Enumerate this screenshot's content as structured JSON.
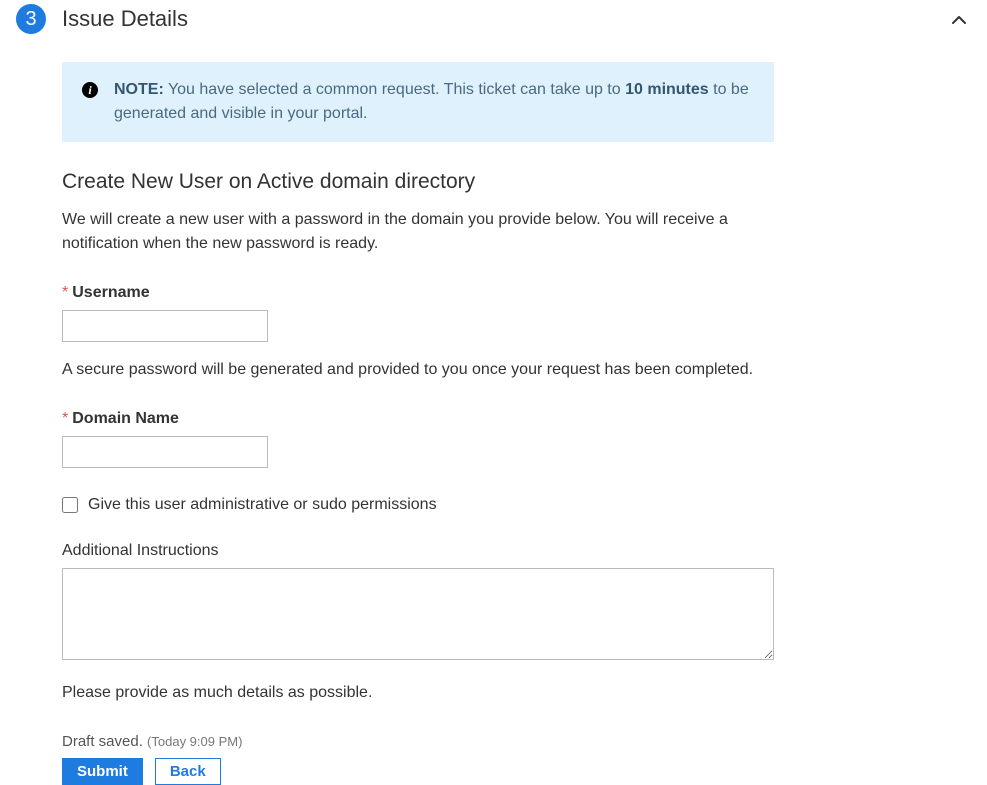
{
  "step": {
    "number": "3",
    "title": "Issue Details"
  },
  "note": {
    "label": "NOTE:",
    "text_before": " You have selected a common request. This ticket can take up to ",
    "bold_duration": "10 minutes",
    "text_after": " to be generated and visible in your portal."
  },
  "form": {
    "title": "Create New User on Active domain directory",
    "description": "We will create a new user with a password in the domain you provide below. You will receive a notification when the new password is ready.",
    "username": {
      "label": "Username",
      "value": "",
      "help": "A secure password will be generated and provided to you once your request has been completed."
    },
    "domain": {
      "label": "Domain Name",
      "value": ""
    },
    "admin_checkbox": {
      "label": "Give this user administrative or sudo permissions",
      "checked": false
    },
    "additional": {
      "label": "Additional Instructions",
      "value": "",
      "help": "Please provide as much details as possible."
    }
  },
  "draft": {
    "text": "Draft saved.",
    "timestamp": "(Today 9:09 PM)"
  },
  "buttons": {
    "submit": "Submit",
    "back": "Back"
  }
}
